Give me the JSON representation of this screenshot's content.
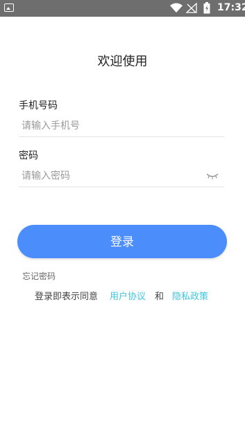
{
  "status_bar": {
    "time": "17:32",
    "icons": [
      "image-icon",
      "wifi-icon",
      "signal-icon",
      "battery-icon"
    ]
  },
  "page": {
    "title": "欢迎使用"
  },
  "form": {
    "phone_label": "手机号码",
    "phone_placeholder": "请输入手机号",
    "phone_value": "",
    "password_label": "密码",
    "password_placeholder": "请输入密码",
    "password_value": "",
    "password_toggle_icon": "eye-closed-icon"
  },
  "actions": {
    "login_label": "登录",
    "forgot_label": "忘记密码"
  },
  "agreement": {
    "prefix": "登录即表示同意",
    "user_agreement": "用户协议",
    "and": "和",
    "privacy_policy": "隐私政策"
  },
  "colors": {
    "primary": "#4a8dfb",
    "link": "#3ec6e0",
    "status_bar": "#6e6e6e"
  }
}
